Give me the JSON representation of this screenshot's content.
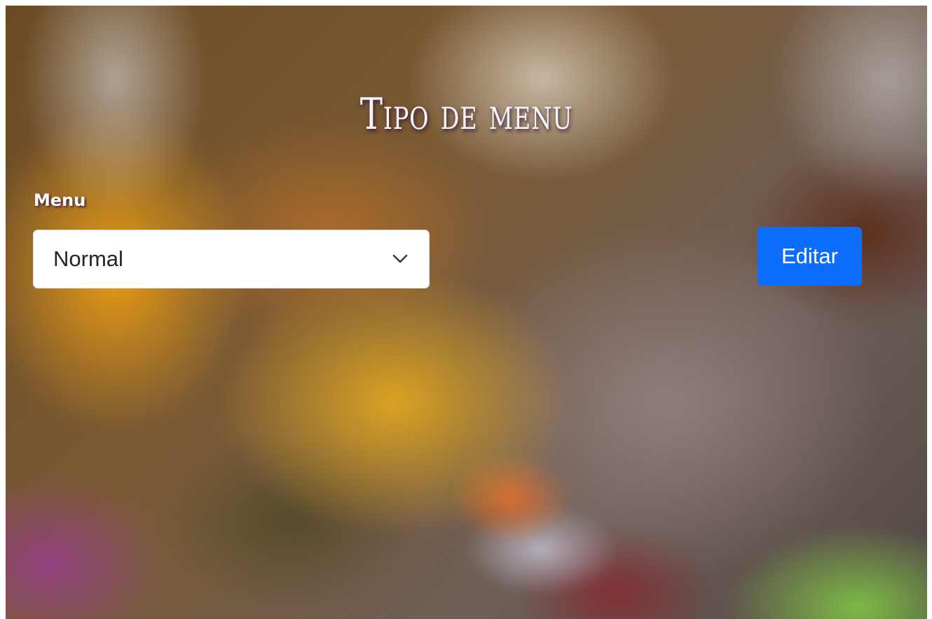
{
  "page": {
    "title": "Tipo de menu"
  },
  "form": {
    "menu_label": "Menu",
    "menu_select": {
      "selected_value": "Normal",
      "icon": "chevron-down-icon"
    },
    "edit_button_label": "Editar"
  },
  "colors": {
    "button_primary": "#0d6efd",
    "select_background": "#ffffff",
    "title_text": "#f7f5f6"
  }
}
